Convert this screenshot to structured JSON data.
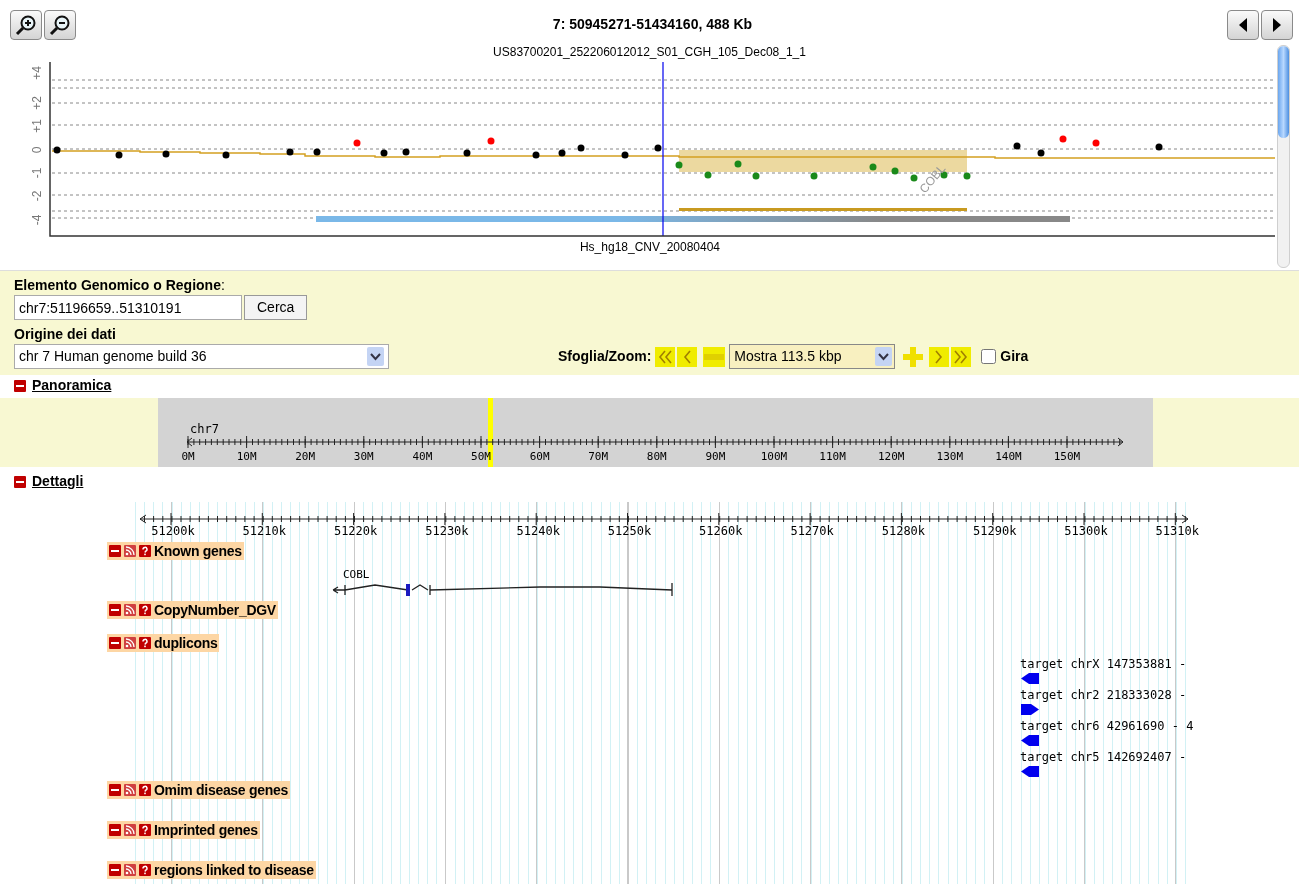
{
  "plot": {
    "title": "7: 50945271-51434160, 488 Kb",
    "subtitle": "US83700201_252206012012_S01_CGH_105_Dec08_1_1",
    "y_tick_labels": [
      "+4",
      "+2",
      "+1",
      "0",
      "-1",
      "-2",
      "-4"
    ],
    "gene_annotation": "COBL",
    "track_label": "Hs_hg18_CNV_20080404"
  },
  "search": {
    "label": "**Elemento Genomico o Regione**:",
    "value": "chr7:51196659..51310191",
    "button": "Cerca"
  },
  "data_source": {
    "label": "Origine dei dati",
    "value": "chr 7 Human genome build 36"
  },
  "navigation": {
    "label": "Sfoglia/Zoom:",
    "zoom_select": "Mostra 113.5 kbp",
    "flip": {
      "label": "Gira",
      "checked": false
    }
  },
  "overview": {
    "title": "Panoramica",
    "expanded": true,
    "chromosome": "chr7",
    "tick_labels": [
      "0M",
      "10M",
      "20M",
      "30M",
      "40M",
      "50M",
      "60M",
      "70M",
      "80M",
      "90M",
      "100M",
      "110M",
      "120M",
      "130M",
      "140M",
      "150M"
    ]
  },
  "details": {
    "title": "Dettagli",
    "expanded": true,
    "tick_labels": [
      "51200k",
      "51210k",
      "51220k",
      "51230k",
      "51240k",
      "51250k",
      "51260k",
      "51270k",
      "51280k",
      "51290k",
      "51300k",
      "51310k"
    ],
    "tracks": [
      {
        "name": "Known genes",
        "kind": "genes",
        "genes": [
          {
            "name": "COBL"
          }
        ]
      },
      {
        "name": "CopyNumber_DGV",
        "kind": "empty"
      },
      {
        "name": "duplicons",
        "kind": "duplicons",
        "hits": [
          {
            "label": "target chrX 147353881 -",
            "kind": "left"
          },
          {
            "label": "target chr2 218333028 -",
            "kind": "right"
          },
          {
            "label": "target chr6 42961690 - 4",
            "kind": "left"
          },
          {
            "label": "target chr5 142692407 -",
            "kind": "left"
          }
        ]
      },
      {
        "name": "Omim disease genes",
        "kind": "empty"
      },
      {
        "name": "Imprinted genes",
        "kind": "empty"
      },
      {
        "name": "regions linked to disease",
        "kind": "empty"
      }
    ]
  }
}
